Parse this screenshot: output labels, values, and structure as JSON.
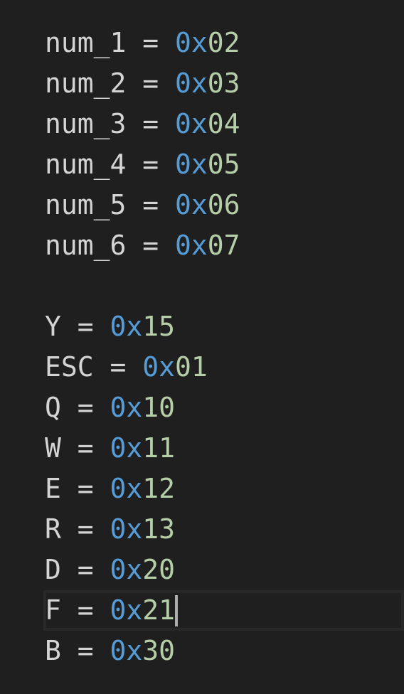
{
  "editor": {
    "lines": [
      {
        "name": "num_1",
        "op": " = ",
        "prefix": "0x",
        "digits": "02"
      },
      {
        "name": "num_2",
        "op": " = ",
        "prefix": "0x",
        "digits": "03"
      },
      {
        "name": "num_3",
        "op": " = ",
        "prefix": "0x",
        "digits": "04"
      },
      {
        "name": "num_4",
        "op": " = ",
        "prefix": "0x",
        "digits": "05"
      },
      {
        "name": "num_5",
        "op": " = ",
        "prefix": "0x",
        "digits": "06"
      },
      {
        "name": "num_6",
        "op": " = ",
        "prefix": "0x",
        "digits": "07"
      },
      {
        "name": "",
        "op": "",
        "prefix": "",
        "digits": ""
      },
      {
        "name": "Y",
        "op": " = ",
        "prefix": "0x",
        "digits": "15"
      },
      {
        "name": "ESC",
        "op": " = ",
        "prefix": "0x",
        "digits": "01"
      },
      {
        "name": "Q",
        "op": " = ",
        "prefix": "0x",
        "digits": "10"
      },
      {
        "name": "W",
        "op": " = ",
        "prefix": "0x",
        "digits": "11"
      },
      {
        "name": "E",
        "op": " = ",
        "prefix": "0x",
        "digits": "12"
      },
      {
        "name": "R",
        "op": " = ",
        "prefix": "0x",
        "digits": "13"
      },
      {
        "name": "D",
        "op": " = ",
        "prefix": "0x",
        "digits": "20"
      },
      {
        "name": "F",
        "op": " = ",
        "prefix": "0x",
        "digits": "21"
      },
      {
        "name": "B",
        "op": " = ",
        "prefix": "0x",
        "digits": "30"
      }
    ]
  },
  "colors": {
    "background": "#1f1f1f",
    "text": "#d4d4d4",
    "hex_prefix": "#569cd6",
    "hex_digits": "#b5cea8",
    "current_line_border": "#282828",
    "cursor": "#aeafad"
  }
}
